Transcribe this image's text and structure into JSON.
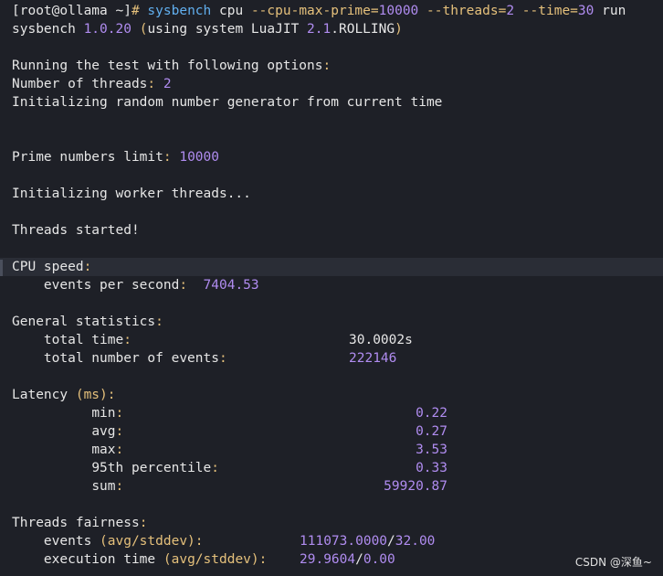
{
  "prompt": {
    "user_host": "[root@ollama ~]",
    "symbol": "#",
    "cmd": "sysbench",
    "arg1": "cpu",
    "opt1": "--cpu-max-prime=",
    "val1": "10000",
    "opt2": "--threads=",
    "val2": "2",
    "opt3": "--time=",
    "val3": "30",
    "arg2": "run"
  },
  "header": {
    "prefix": "sysbench ",
    "version": "1.0.20",
    "open": " (",
    "using": "using system LuaJIT",
    "luajit_version": "2.1",
    "rolling": ".ROLLING",
    "close": ")"
  },
  "options": {
    "title": "Running the test with following options",
    "colon": ":",
    "threads_label": "Number of threads",
    "threads_value": "2",
    "init_rng": "Initializing random number generator from current time"
  },
  "prime": {
    "label": "Prime numbers limit",
    "value": "10000"
  },
  "init_workers": "Initializing worker threads...",
  "threads_started": "Threads started!",
  "cpu_speed": {
    "title": "CPU speed",
    "eps_label": "events per second",
    "eps_value": "7404.53"
  },
  "general": {
    "title": "General statistics",
    "total_time_label": "total time",
    "total_time_value": "30.0002s",
    "total_events_label": "total number of events",
    "total_events_value": "222146"
  },
  "latency": {
    "title_a": "Latency ",
    "title_b": "(ms)",
    "min_label": "min",
    "min_value": "0.22",
    "avg_label": "avg",
    "avg_value": "0.27",
    "max_label": "max",
    "max_value": "3.53",
    "p95_label": "95th percentile",
    "p95_value": "0.33",
    "sum_label": "sum",
    "sum_value": "59920.87"
  },
  "fairness": {
    "title": "Threads fairness",
    "events_label": "events ",
    "events_paren": "(avg/stddev)",
    "events_avg": "111073.0000",
    "events_sep": "/",
    "events_std": "32.00",
    "exec_label": "execution time ",
    "exec_paren": "(avg/stddev)",
    "exec_avg": "29.9604",
    "exec_sep": "/",
    "exec_std": "0.00"
  },
  "watermark": "CSDN @深鱼~",
  "colors": {
    "background": "#1e2027",
    "text": "#e6e6e6",
    "number": "#b08cf0",
    "punct": "#e5c07b",
    "command": "#61afef",
    "highlight_row": "#2a2d36"
  }
}
